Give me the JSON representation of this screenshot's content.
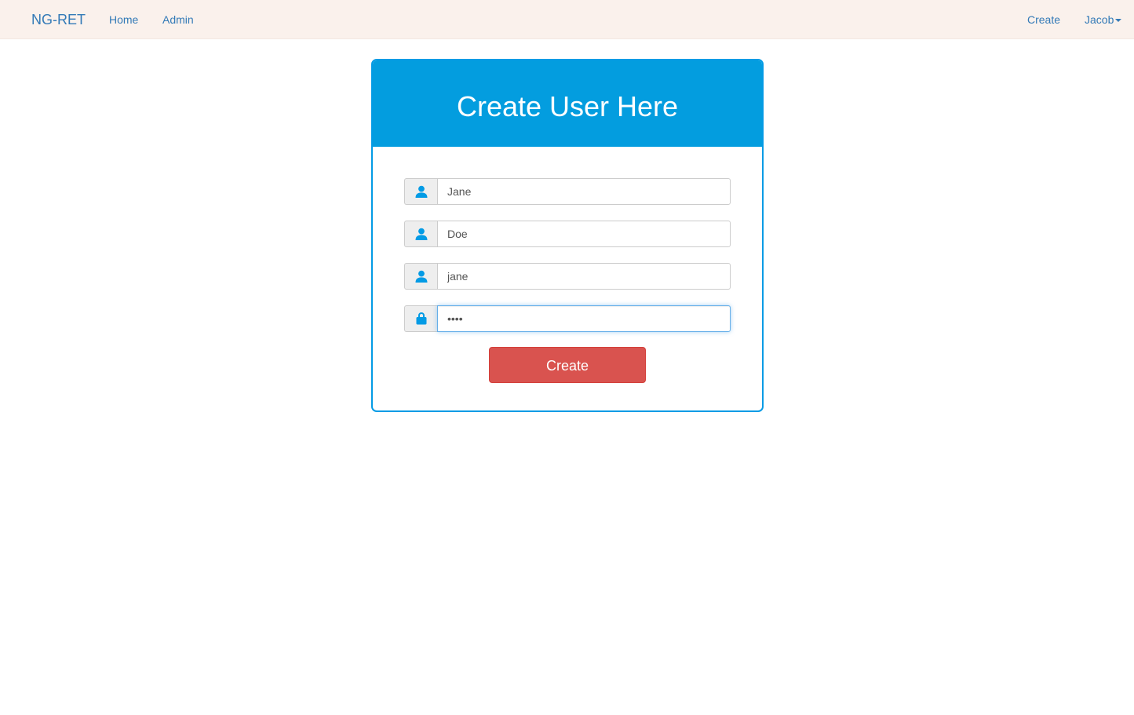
{
  "navbar": {
    "brand": "NG-RET",
    "links": [
      {
        "label": "Home"
      },
      {
        "label": "Admin"
      }
    ],
    "right_links": {
      "create": "Create",
      "user": "Jacob"
    }
  },
  "panel": {
    "title": "Create User Here",
    "fields": [
      {
        "icon": "user-icon",
        "value": "Jane"
      },
      {
        "icon": "user-icon",
        "value": "Doe"
      },
      {
        "icon": "user-icon",
        "value": "jane"
      },
      {
        "icon": "lock-icon",
        "value": "••••",
        "type": "password",
        "focused": true
      }
    ],
    "submit_label": "Create"
  },
  "colors": {
    "navbar_bg": "#faf1ec",
    "link": "#337ab7",
    "accent": "#039ddf",
    "button": "#d9534f",
    "icon": "#039be5"
  }
}
